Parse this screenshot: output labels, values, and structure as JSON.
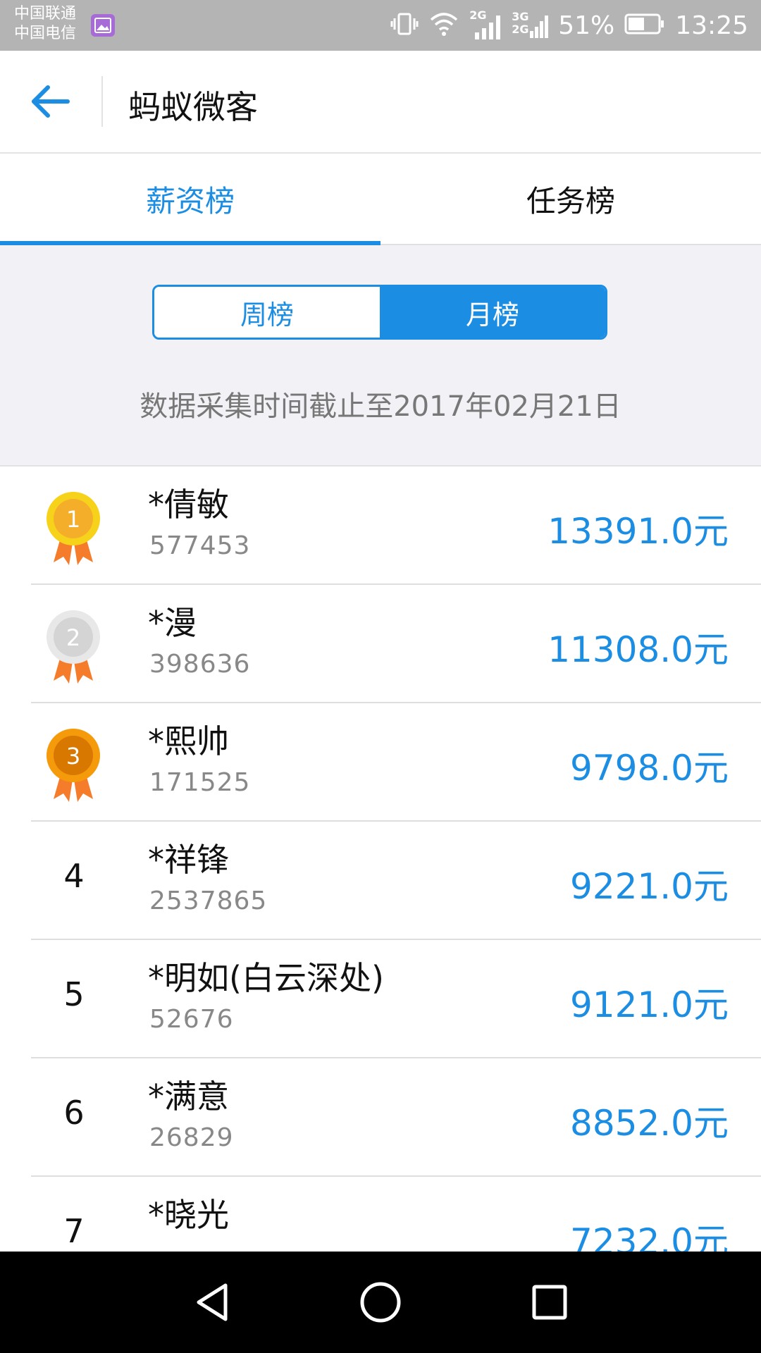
{
  "status_bar": {
    "carrier_1": "中国联通",
    "carrier_2": "中国电信",
    "net_1": "2G",
    "net_2a": "3G",
    "net_2b": "2G",
    "battery": "51%",
    "time": "13:25"
  },
  "header": {
    "title": "蚂蚁微客"
  },
  "tabs": [
    {
      "label": "薪资榜",
      "active": true
    },
    {
      "label": "任务榜",
      "active": false
    }
  ],
  "segment": {
    "week": "周榜",
    "month": "月榜",
    "selected": "月榜"
  },
  "cutoff_text": "数据采集时间截止至2017年02月21日",
  "rankings": [
    {
      "rank": "1",
      "name": "*倩敏",
      "id": "577453",
      "amount": "13391.0元"
    },
    {
      "rank": "2",
      "name": "*漫",
      "id": "398636",
      "amount": "11308.0元"
    },
    {
      "rank": "3",
      "name": "*熙帅",
      "id": "171525",
      "amount": "9798.0元"
    },
    {
      "rank": "4",
      "name": "*祥锋",
      "id": "2537865",
      "amount": "9221.0元"
    },
    {
      "rank": "5",
      "name": "*明如(白云深处)",
      "id": "52676",
      "amount": "9121.0元"
    },
    {
      "rank": "6",
      "name": "*满意",
      "id": "26829",
      "amount": "8852.0元"
    },
    {
      "rank": "7",
      "name": "*晓光",
      "id": "",
      "amount": "7232.0元"
    }
  ],
  "colors": {
    "accent": "#1b8de3",
    "gold": "#f7c21a",
    "silver": "#d9d9d9",
    "bronze": "#f08a00",
    "ribbon": "#f57c2a"
  }
}
